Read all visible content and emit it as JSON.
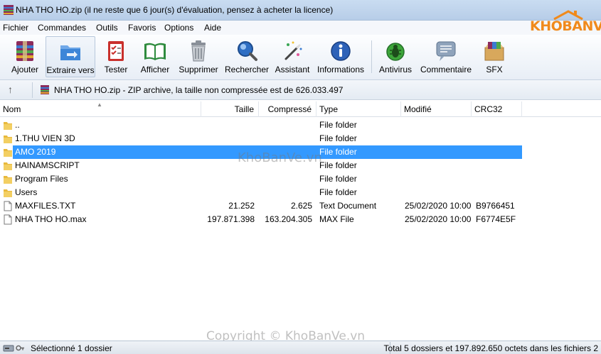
{
  "window": {
    "title": "NHA THO HO.zip (il ne reste que 6 jour(s) d'évaluation, pensez à acheter la licence)",
    "logo_text": "KHOBANVE"
  },
  "menu": [
    "Fichier",
    "Commandes",
    "Outils",
    "Favoris",
    "Options",
    "Aide"
  ],
  "toolbar": {
    "items": [
      {
        "label": "Ajouter",
        "icon": "add-archive-icon"
      },
      {
        "label": "Extraire vers",
        "icon": "extract-folder-icon"
      },
      {
        "label": "Tester",
        "icon": "test-checklist-icon"
      },
      {
        "label": "Afficher",
        "icon": "view-book-icon"
      },
      {
        "label": "Supprimer",
        "icon": "trash-icon"
      },
      {
        "label": "Rechercher",
        "icon": "magnifier-icon"
      },
      {
        "label": "Assistant",
        "icon": "wizard-wand-icon"
      },
      {
        "label": "Informations",
        "icon": "info-icon"
      },
      {
        "label": "Antivirus",
        "icon": "antivirus-bug-icon"
      },
      {
        "label": "Commentaire",
        "icon": "comment-icon"
      },
      {
        "label": "SFX",
        "icon": "sfx-box-icon"
      }
    ]
  },
  "pathbar": {
    "up_symbol": "↑",
    "text": "NHA THO HO.zip - ZIP archive, la taille non compressée est de 626.033.497"
  },
  "columns": {
    "name": "Nom",
    "size": "Taille",
    "packed": "Compressé",
    "type": "Type",
    "modified": "Modifié",
    "crc": "CRC32"
  },
  "files": [
    {
      "name": "..",
      "size": "",
      "packed": "",
      "type": "File folder",
      "modified": "",
      "crc": "",
      "kind": "folder"
    },
    {
      "name": "1.THU VIEN 3D",
      "size": "",
      "packed": "",
      "type": "File folder",
      "modified": "",
      "crc": "",
      "kind": "folder"
    },
    {
      "name": "AMO 2019",
      "size": "",
      "packed": "",
      "type": "File folder",
      "modified": "",
      "crc": "",
      "kind": "folder",
      "selected": true
    },
    {
      "name": "HAINAMSCRIPT",
      "size": "",
      "packed": "",
      "type": "File folder",
      "modified": "",
      "crc": "",
      "kind": "folder"
    },
    {
      "name": "Program Files",
      "size": "",
      "packed": "",
      "type": "File folder",
      "modified": "",
      "crc": "",
      "kind": "folder"
    },
    {
      "name": "Users",
      "size": "",
      "packed": "",
      "type": "File folder",
      "modified": "",
      "crc": "",
      "kind": "folder"
    },
    {
      "name": "MAXFILES.TXT",
      "size": "21.252",
      "packed": "2.625",
      "type": "Text Document",
      "modified": "25/02/2020 10:00",
      "crc": "B9766451",
      "kind": "file"
    },
    {
      "name": "NHA THO HO.max",
      "size": "197.871.398",
      "packed": "163.204.305",
      "type": "MAX File",
      "modified": "25/02/2020 10:00",
      "crc": "F6774E5F",
      "kind": "file"
    }
  ],
  "watermark": "KhoBanVe.vn",
  "copyright": "Copyright © KhoBanVe.vn",
  "status": {
    "left": "Sélectionné 1 dossier",
    "right": "Total 5 dossiers et 197.892.650 octets dans les fichiers 2"
  },
  "colors": {
    "selection": "#3399ff",
    "folder": "#e8b93c",
    "logo": "#f08a1c"
  }
}
